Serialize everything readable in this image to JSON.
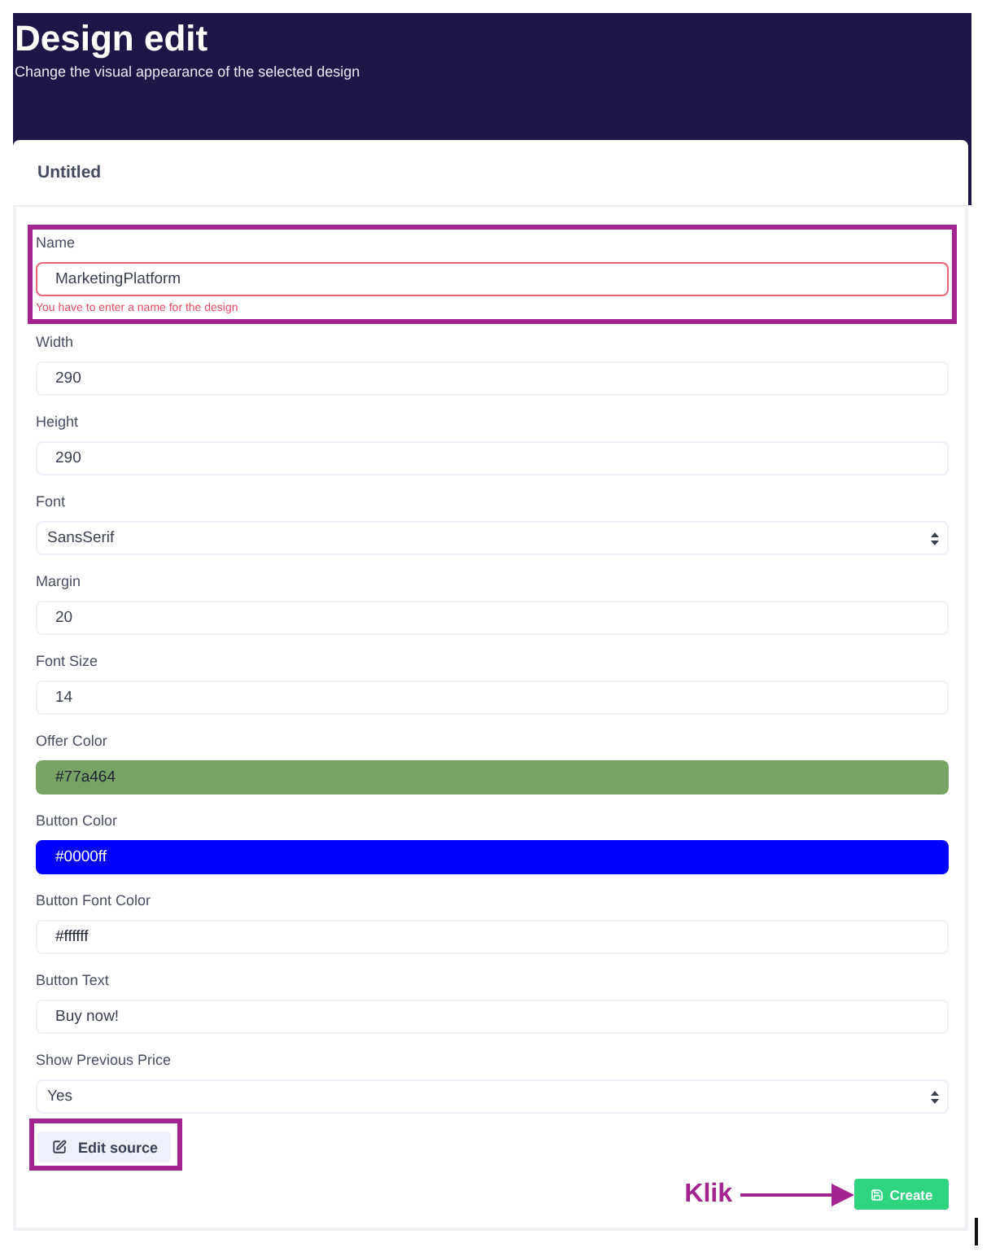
{
  "page": {
    "title": "Design edit",
    "subtitle": "Change the visual appearance of the selected design"
  },
  "card": {
    "title": "Untitled"
  },
  "fields": [
    {
      "kind": "text",
      "label": "Name",
      "value": "MarketingPlatform",
      "invalid": true,
      "error": "You have to enter a name for the design",
      "highlighted": true
    },
    {
      "kind": "text",
      "label": "Width",
      "value": "290",
      "invalid": false,
      "highlighted": false
    },
    {
      "kind": "text",
      "label": "Height",
      "value": "290",
      "invalid": false,
      "highlighted": false
    },
    {
      "kind": "select",
      "label": "Font",
      "value": "SansSerif",
      "invalid": false,
      "highlighted": false
    },
    {
      "kind": "text",
      "label": "Margin",
      "value": "20",
      "invalid": false,
      "highlighted": false
    },
    {
      "kind": "text",
      "label": "Font Size",
      "value": "14",
      "invalid": false,
      "highlighted": false
    },
    {
      "kind": "color",
      "label": "Offer Color",
      "value": "#77a464",
      "color": "#77a464",
      "invalid": false,
      "highlighted": false
    },
    {
      "kind": "color",
      "label": "Button Color",
      "value": "#0000ff",
      "color": "#0000ff",
      "invalid": false,
      "highlighted": false
    },
    {
      "kind": "color",
      "label": "Button Font Color",
      "value": "#ffffff",
      "color": "#ffffff",
      "invalid": false,
      "highlighted": false
    },
    {
      "kind": "text",
      "label": "Button Text",
      "value": "Buy now!",
      "invalid": false,
      "highlighted": false
    },
    {
      "kind": "select",
      "label": "Show Previous Price",
      "value": "Yes",
      "invalid": false,
      "highlighted": false
    }
  ],
  "edit_source_button": {
    "label": "Edit source",
    "highlighted": true
  },
  "annotation": {
    "label": "Klik"
  },
  "create_button": {
    "label": "Create"
  }
}
